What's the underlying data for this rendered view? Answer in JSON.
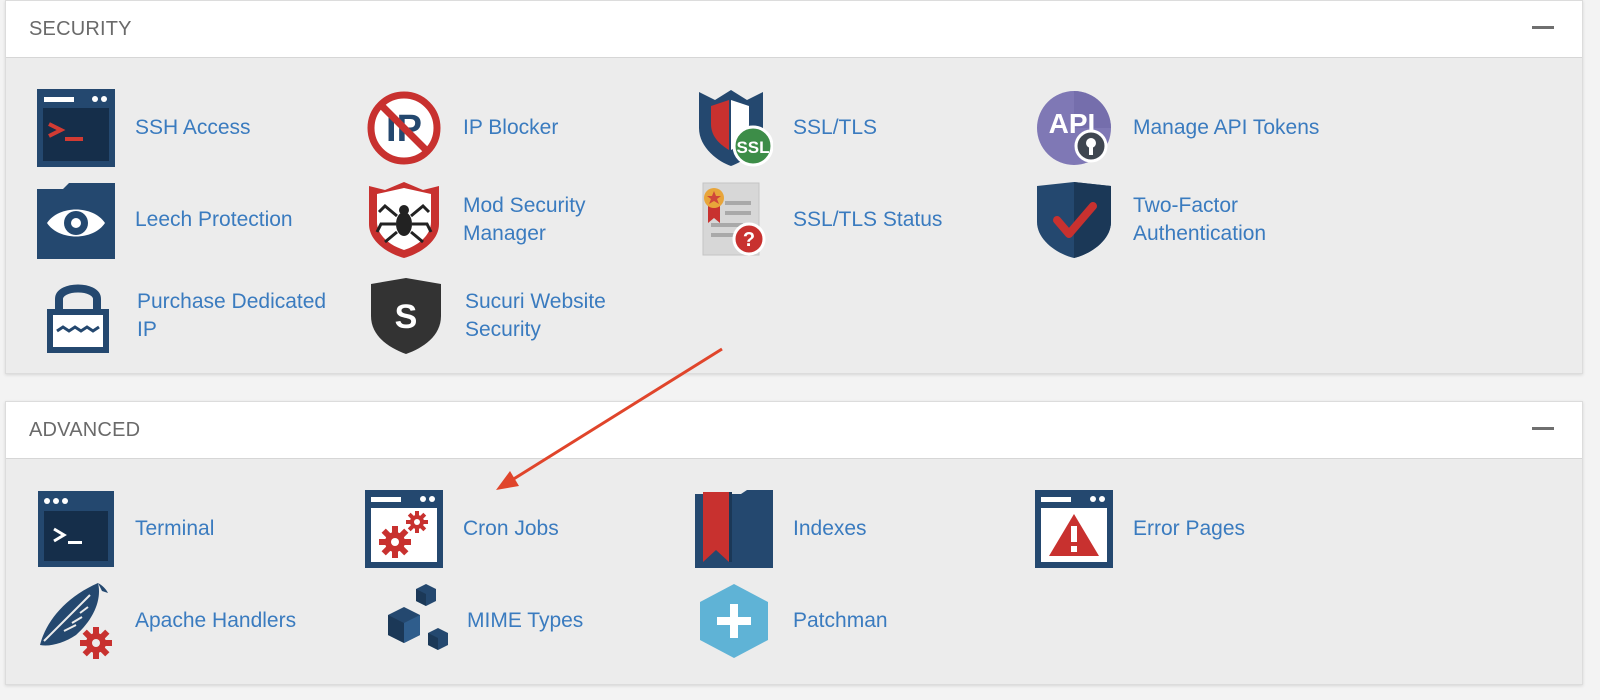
{
  "security": {
    "title": "SECURITY",
    "items": [
      {
        "label": "SSH Access",
        "icon": "terminal-window-icon"
      },
      {
        "label": "IP Blocker",
        "icon": "ip-blocked-icon"
      },
      {
        "label": "SSL/TLS",
        "icon": "ssl-shield-icon"
      },
      {
        "label": "Manage API Tokens",
        "icon": "api-key-icon"
      },
      {
        "label": "Leech Protection",
        "icon": "eye-folder-icon"
      },
      {
        "label": "Mod Security Manager",
        "icon": "spider-shield-icon"
      },
      {
        "label": "SSL/TLS Status",
        "icon": "certificate-question-icon"
      },
      {
        "label": "Two-Factor Authentication",
        "icon": "checkmark-shield-icon"
      },
      {
        "label": "Purchase Dedicated IP",
        "icon": "padlock-icon"
      },
      {
        "label": "Sucuri Website Security",
        "icon": "sucuri-shield-icon"
      }
    ]
  },
  "advanced": {
    "title": "ADVANCED",
    "items": [
      {
        "label": "Terminal",
        "icon": "terminal-icon"
      },
      {
        "label": "Cron Jobs",
        "icon": "cron-gears-icon"
      },
      {
        "label": "Indexes",
        "icon": "index-bookmark-icon"
      },
      {
        "label": "Error Pages",
        "icon": "error-warning-icon"
      },
      {
        "label": "Apache Handlers",
        "icon": "feather-gear-icon"
      },
      {
        "label": "MIME Types",
        "icon": "cubes-icon"
      },
      {
        "label": "Patchman",
        "icon": "plus-hexagon-icon"
      }
    ]
  },
  "colors": {
    "link": "#3a7bbf",
    "navy": "#24486f",
    "red": "#c8312f",
    "annotation_arrow": "#e0452b"
  }
}
